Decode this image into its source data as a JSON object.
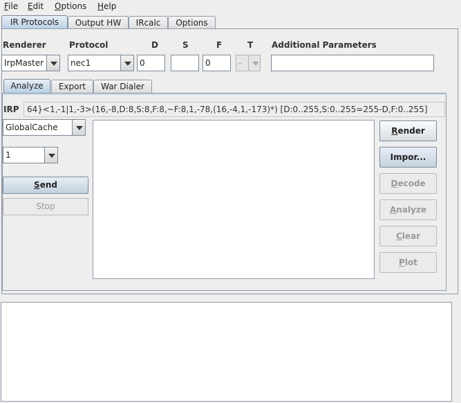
{
  "menubar": {
    "file": {
      "mnemonic": "F",
      "rest": "ile"
    },
    "edit": {
      "mnemonic": "E",
      "rest": "dit"
    },
    "options": {
      "mnemonic": "O",
      "rest": "ptions"
    },
    "help": {
      "mnemonic": "H",
      "rest": "elp"
    }
  },
  "main_tabs": [
    "IR Protocols",
    "Output HW",
    "IRcalc",
    "Options"
  ],
  "params": {
    "renderer_label": "Renderer",
    "protocol_label": "Protocol",
    "d_label": "D",
    "s_label": "S",
    "f_label": "F",
    "t_label": "T",
    "additional_label": "Additional Parameters",
    "renderer_value": "IrpMaster",
    "protocol_value": "nec1",
    "d_value": "0",
    "s_value": "",
    "f_value": "0",
    "t_value": "-",
    "additional_value": ""
  },
  "sub_tabs": [
    "Analyze",
    "Export",
    "War Dialer"
  ],
  "irp": {
    "label": "IRP",
    "value": "64}<1,-1|1,-3>(16,-8,D:8,S:8,F:8,~F:8,1,-78,(16,-4,1,-173)*) [D:0..255,S:0..255=255-D,F:0..255]"
  },
  "left": {
    "hardware_value": "GlobalCache",
    "count_value": "1",
    "send": {
      "mnemonic": "S",
      "rest": "end"
    },
    "stop_label": "Stop"
  },
  "buttons": {
    "render": {
      "mnemonic": "R",
      "rest": "ender"
    },
    "import_label": "Impor...",
    "decode": {
      "mnemonic": "D",
      "rest": "ecode"
    },
    "analyze": {
      "mnemonic": "A",
      "rest": "nalyze"
    },
    "clear": {
      "mnemonic": "C",
      "rest": "lear"
    },
    "plot": {
      "mnemonic": "P",
      "rest": "lot"
    }
  }
}
